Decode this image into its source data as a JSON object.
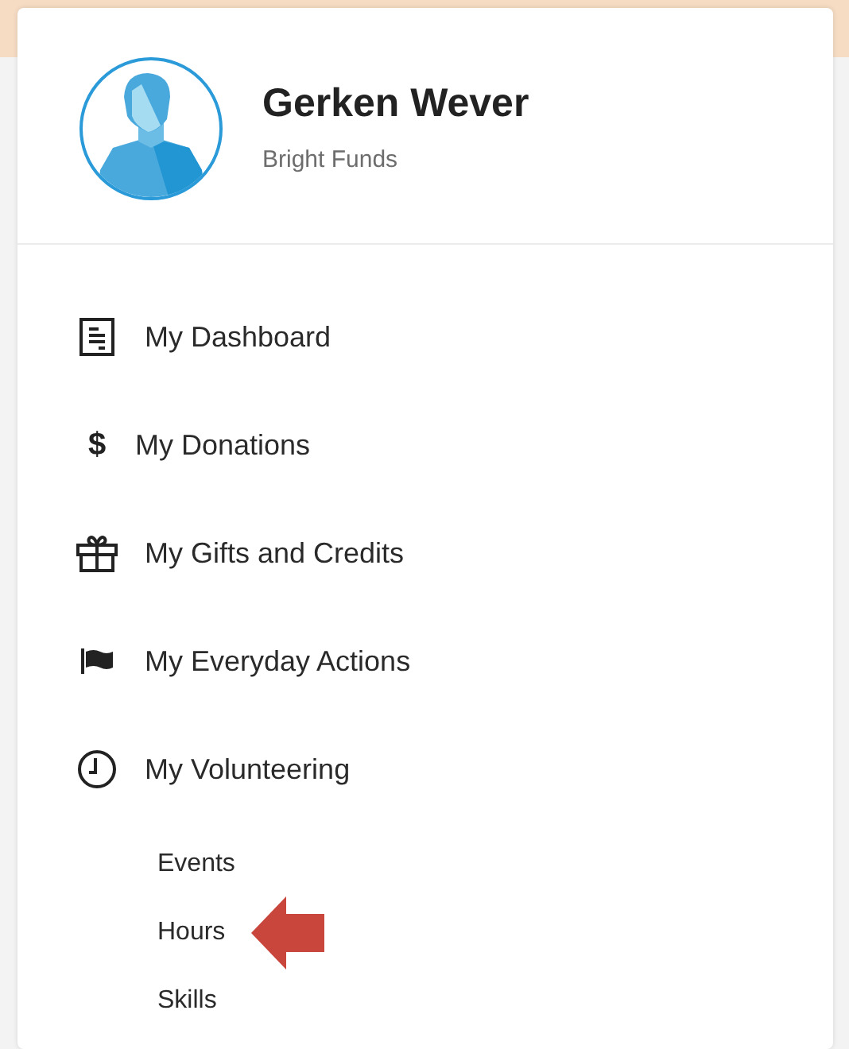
{
  "profile": {
    "name": "Gerken Wever",
    "organization": "Bright Funds"
  },
  "menu": [
    {
      "kind": "dashboard",
      "label": "My Dashboard"
    },
    {
      "kind": "dollar",
      "label": "My Donations",
      "icon_text": "$"
    },
    {
      "kind": "gift",
      "label": "My Gifts and Credits"
    },
    {
      "kind": "flag",
      "label": "My Everyday Actions"
    },
    {
      "kind": "clock",
      "label": "My Volunteering",
      "expanded": true,
      "children": [
        {
          "label": "Events",
          "callout": false
        },
        {
          "label": "Hours",
          "callout": true
        },
        {
          "label": "Skills",
          "callout": false
        }
      ]
    }
  ]
}
